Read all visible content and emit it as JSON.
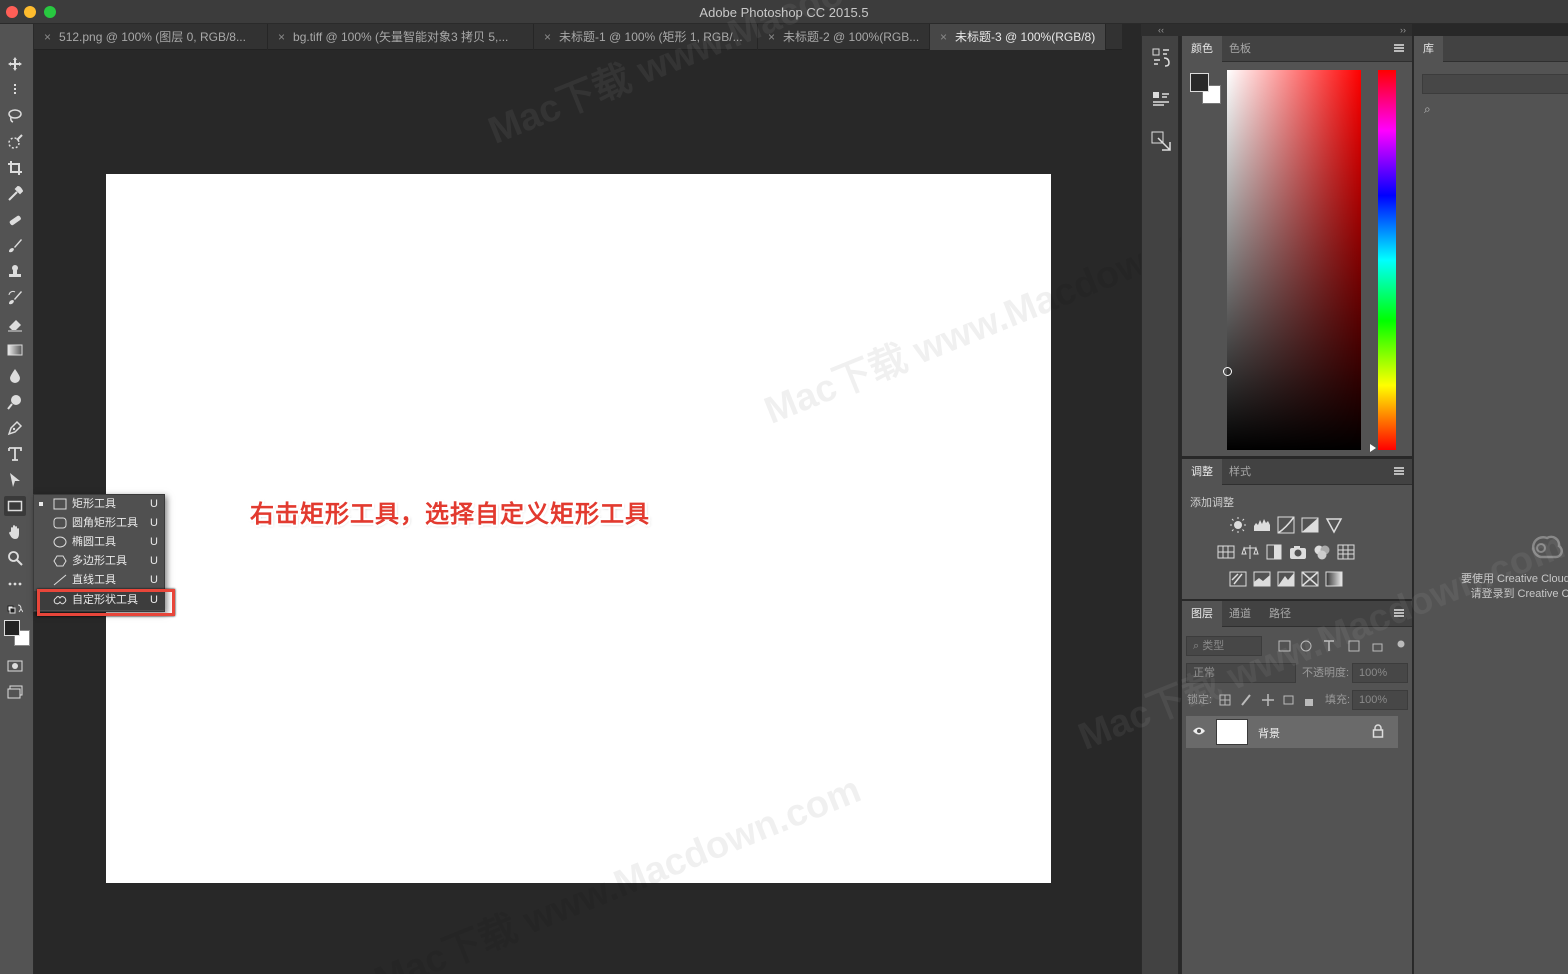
{
  "window": {
    "title": "Adobe Photoshop CC 2015.5"
  },
  "tabs": [
    {
      "label": "512.png @ 100% (图层 0, RGB/8...",
      "active": false
    },
    {
      "label": "bg.tiff @ 100% (矢量智能对象3 拷贝 5,...",
      "active": false
    },
    {
      "label": "未标题-1 @ 100% (矩形 1, RGB/...",
      "active": false
    },
    {
      "label": "未标题-2 @ 100%(RGB...",
      "active": false
    },
    {
      "label": "未标题-3 @ 100%(RGB/8)",
      "active": true
    }
  ],
  "tools": [
    "move-icon",
    "marquee-icon",
    "lasso-icon",
    "quick-select-icon",
    "crop-icon",
    "eyedropper-icon",
    "healing-icon",
    "brush-icon",
    "stamp-icon",
    "history-brush-icon",
    "eraser-icon",
    "gradient-icon",
    "blur-icon",
    "dodge-icon",
    "pen-icon",
    "type-icon",
    "path-select-icon",
    "rectangle-icon",
    "hand-icon",
    "zoom-icon",
    "more-icon"
  ],
  "flyout": {
    "items": [
      {
        "label": "矩形工具",
        "key": "U",
        "icon": "rect",
        "current": true
      },
      {
        "label": "圆角矩形工具",
        "key": "U",
        "icon": "rounded-rect",
        "current": false
      },
      {
        "label": "椭圆工具",
        "key": "U",
        "icon": "ellipse",
        "current": false
      },
      {
        "label": "多边形工具",
        "key": "U",
        "icon": "polygon",
        "current": false
      },
      {
        "label": "直线工具",
        "key": "U",
        "icon": "line",
        "current": false
      },
      {
        "label": "自定形状工具",
        "key": "U",
        "icon": "custom-shape",
        "current": false
      }
    ]
  },
  "annotation": "右击矩形工具，选择自定义矩形工具",
  "color_panel": {
    "tabs": [
      "颜色",
      "色板"
    ],
    "foreground": "#2a2a2a",
    "background": "#ffffff",
    "hue_color": "#ff0000"
  },
  "adjust_panel": {
    "tabs": [
      "调整",
      "样式"
    ],
    "add_label": "添加调整"
  },
  "layers_panel": {
    "tabs": [
      "图层",
      "通道",
      "路径"
    ],
    "filter_placeholder": "类型",
    "blend_mode": "正常",
    "opacity_label": "不透明度:",
    "opacity_value": "100%",
    "lock_label": "锁定:",
    "fill_label": "填充:",
    "fill_value": "100%",
    "layers": [
      {
        "name": "背景",
        "visible": true,
        "locked": true
      }
    ]
  },
  "library_panel": {
    "tab": "库",
    "message_line1": "要使用 Creative Cloud L",
    "message_line2": "请登录到 Creative C"
  },
  "watermark": "Mac下载 www.Macdown.com"
}
